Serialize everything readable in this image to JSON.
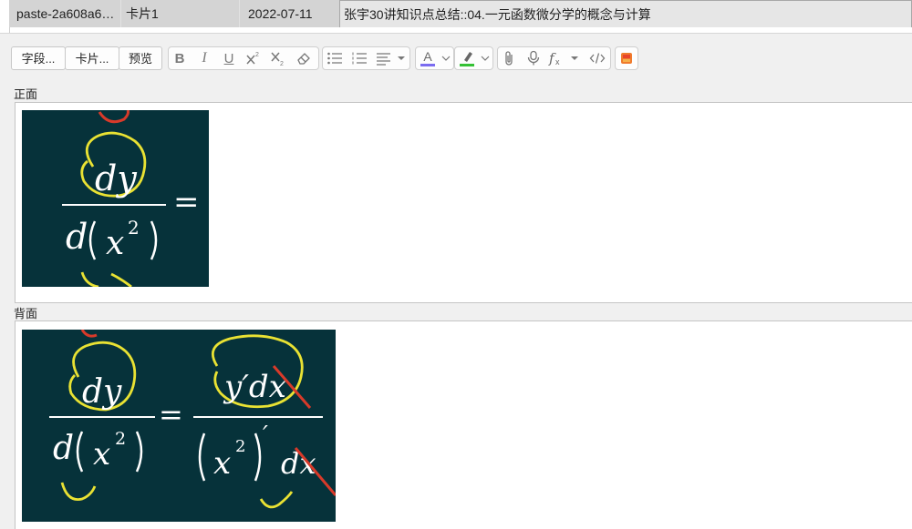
{
  "browser_row": {
    "sort_field": "paste-2a608a6…",
    "card": "卡片1",
    "due": "2022-07-11",
    "deck": "张宇30讲知识点总结::04.一元函数微分学的概念与计算"
  },
  "toolbar": {
    "fields_button": "字段...",
    "cards_button": "卡片...",
    "preview_button": "预览",
    "bold_icon": "B",
    "italic_icon": "I",
    "underline_icon": "U",
    "text_color_icon": "A",
    "accent_colors": {
      "text_color": "#7b6cf0",
      "highlight": "#35c135",
      "record": "#e8442a"
    }
  },
  "front": {
    "label": "正面",
    "image": {
      "numerator": "dy",
      "denominator_d": "d",
      "denominator_x": "x",
      "exponent": "2",
      "equals": "="
    }
  },
  "back": {
    "label": "背面",
    "image": {
      "numerator": "dy",
      "denominator_d": "d",
      "denominator_x": "x",
      "exponent": "2",
      "equals": "=",
      "rhs_numerator": "y′dx",
      "rhs_denominator_x": "x",
      "rhs_exponent": "2",
      "rhs_prime": "′",
      "rhs_dx": "dx"
    }
  }
}
